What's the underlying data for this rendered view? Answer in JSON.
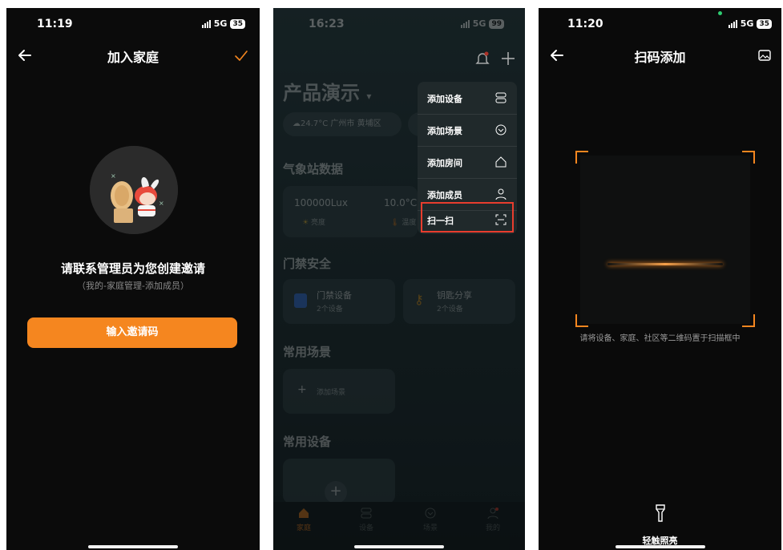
{
  "panel1": {
    "status": {
      "time": "11:19",
      "network": "5G",
      "battery": "35"
    },
    "nav": {
      "title": "加入家庭"
    },
    "message": {
      "title": "请联系管理员为您创建邀请",
      "subtitle": "（我的-家庭管理-添加成员）"
    },
    "button": {
      "label": "输入邀请码"
    }
  },
  "panel2": {
    "status": {
      "time": "16:23",
      "network": "5G",
      "battery": "99"
    },
    "home": {
      "name": "产品演示",
      "weather": "24.7°C 广州市 黄埔区"
    },
    "sections": {
      "weather_station": "气象站数据",
      "access": "门禁安全",
      "scenes": "常用场景",
      "devices": "常用设备"
    },
    "weather_card": {
      "lux_value": "100000Lux",
      "lux_label": "亮度",
      "temp_value": "10.0°C",
      "temp_label": "温度"
    },
    "access_cards": [
      {
        "title": "门禁设备",
        "count": "2个设备"
      },
      {
        "title": "钥匙分享",
        "count": "2个设备"
      }
    ],
    "add_scene": "添加场景",
    "menu": [
      {
        "label": "添加设备",
        "icon": "device-icon"
      },
      {
        "label": "添加场景",
        "icon": "scene-icon"
      },
      {
        "label": "添加房间",
        "icon": "room-icon"
      },
      {
        "label": "添加成员",
        "icon": "member-icon"
      },
      {
        "label": "扫一扫",
        "icon": "scan-icon"
      }
    ],
    "tabs": [
      {
        "label": "家庭",
        "icon": "home-icon"
      },
      {
        "label": "设备",
        "icon": "device-icon"
      },
      {
        "label": "场景",
        "icon": "scene-icon"
      },
      {
        "label": "我的",
        "icon": "profile-icon"
      }
    ],
    "accent": "#f5861f",
    "highlight": "#e83d2e"
  },
  "panel3": {
    "status": {
      "time": "11:20",
      "network": "5G",
      "battery": "35"
    },
    "nav": {
      "title": "扫码添加"
    },
    "hint": "请将设备、家庭、社区等二维码置于扫描框中",
    "torch_label": "轻触照亮"
  }
}
